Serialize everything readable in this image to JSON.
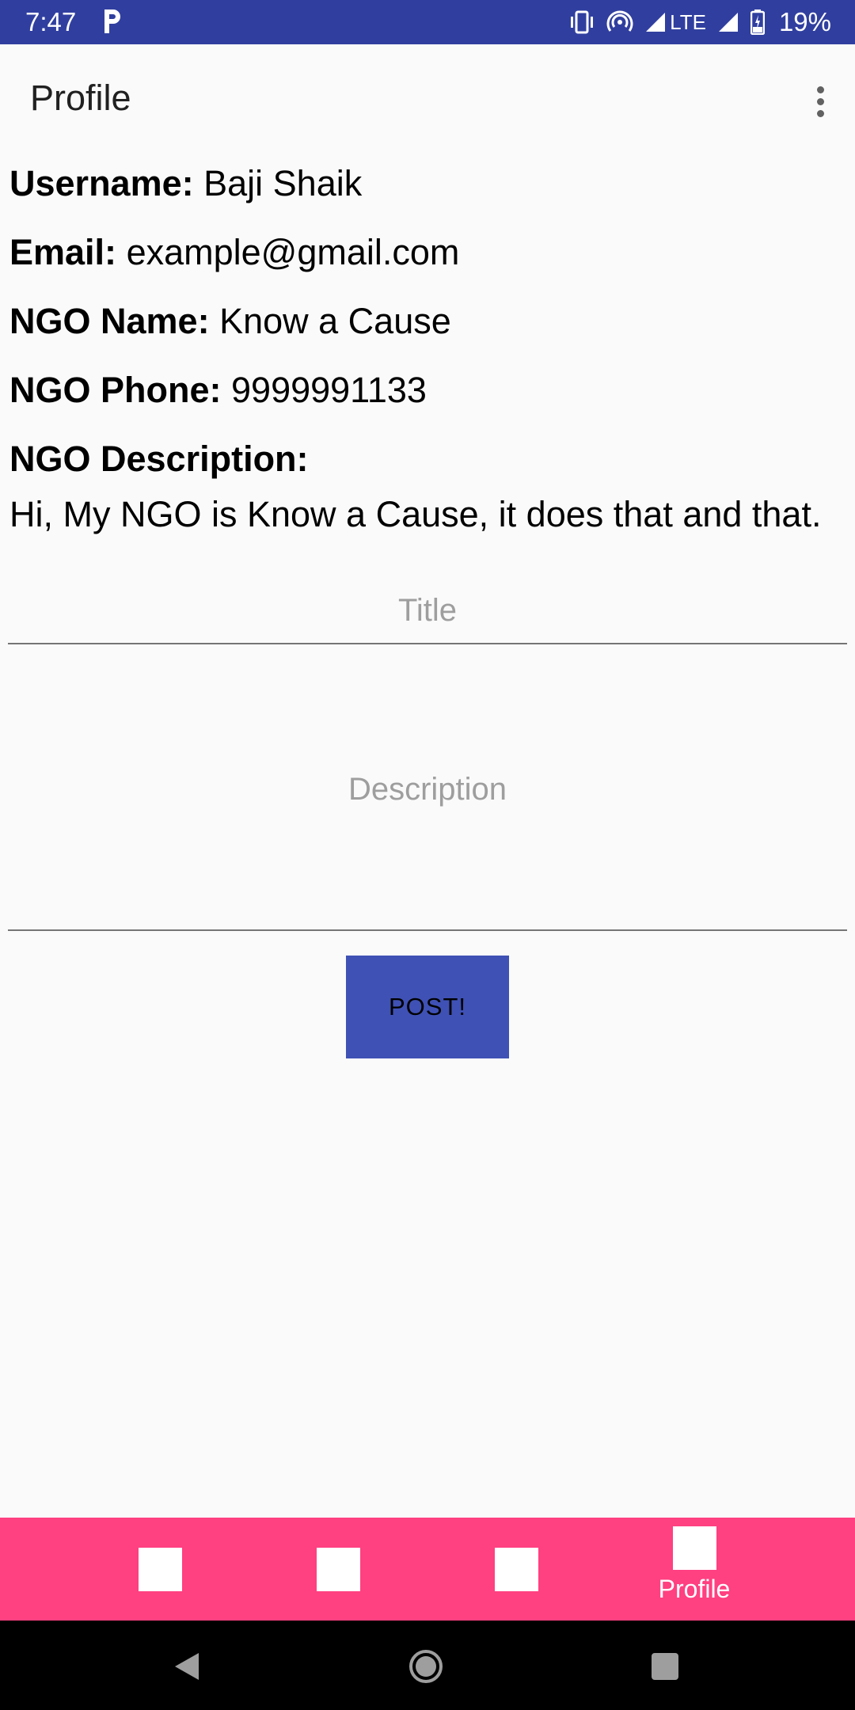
{
  "status_bar": {
    "time": "7:47",
    "network": "LTE",
    "battery": "19%"
  },
  "app_bar": {
    "title": "Profile"
  },
  "profile": {
    "username_label": "Username:",
    "username": "Baji Shaik",
    "email_label": "Email:",
    "email": "example@gmail.com",
    "ngo_name_label": "NGO Name:",
    "ngo_name": "Know a Cause",
    "ngo_phone_label": "NGO Phone:",
    "ngo_phone": "9999991133",
    "ngo_description_label": "NGO Description:",
    "ngo_description": "Hi, My NGO is Know a Cause, it does that and that."
  },
  "form": {
    "title_placeholder": "Title",
    "description_placeholder": "Description",
    "post_label": "POST!"
  },
  "bottom_nav": {
    "items": [
      {
        "label": "",
        "icon": "square-icon"
      },
      {
        "label": "",
        "icon": "square-icon"
      },
      {
        "label": "",
        "icon": "square-icon"
      },
      {
        "label": "Profile",
        "icon": "square-icon",
        "active": true
      }
    ]
  },
  "colors": {
    "status_bar": "#303f9f",
    "primary": "#3f51b5",
    "accent": "#ff4081",
    "background": "#fafafa"
  }
}
